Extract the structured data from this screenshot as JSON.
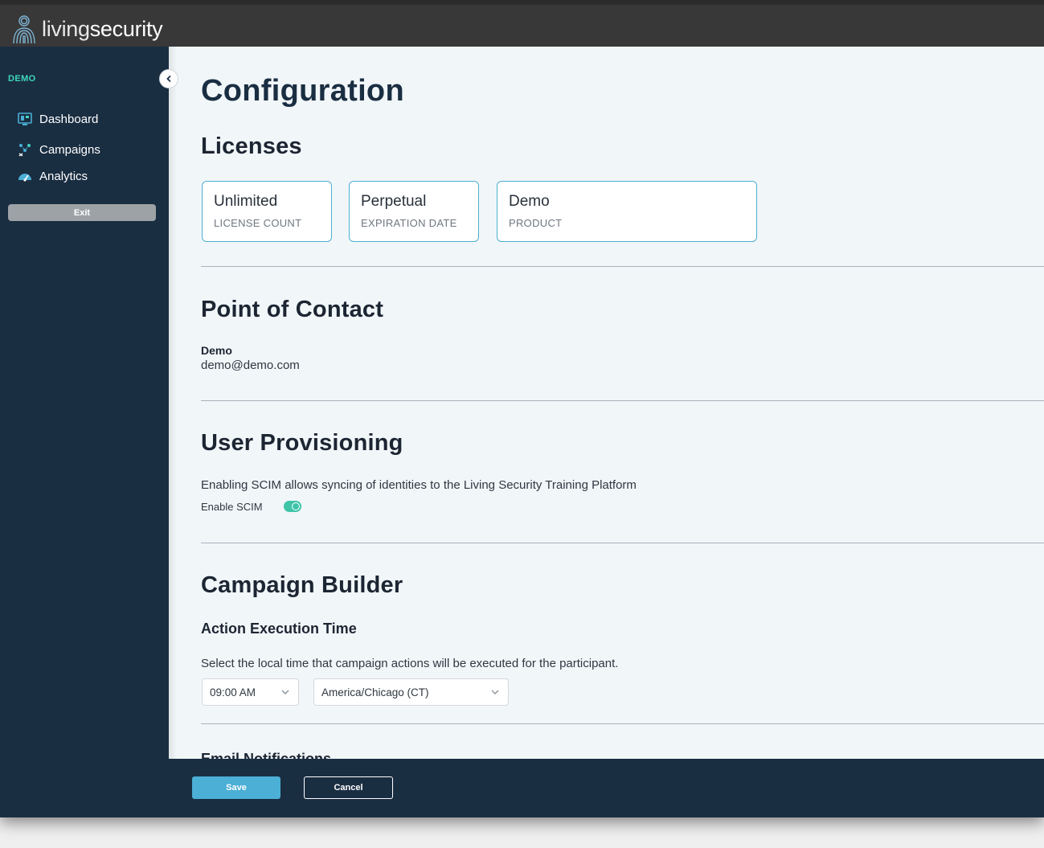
{
  "app": {
    "brand_light": "living",
    "brand_bold": "security",
    "logo_icon": "fingerprint-person-logo"
  },
  "sidebar": {
    "org": "DEMO",
    "collapse_icon": "chevron-left-icon",
    "items": [
      {
        "label": "Dashboard",
        "icon": "dashboard-icon"
      },
      {
        "label": "Campaigns",
        "icon": "campaigns-icon"
      },
      {
        "label": "Analytics",
        "icon": "analytics-icon"
      }
    ],
    "exit_label": "Exit"
  },
  "main": {
    "title": "Configuration",
    "licenses": {
      "heading": "Licenses",
      "cards": [
        {
          "value": "Unlimited",
          "caption": "LICENSE COUNT"
        },
        {
          "value": "Perpetual",
          "caption": "EXPIRATION DATE"
        },
        {
          "value": "Demo",
          "caption": "PRODUCT"
        }
      ]
    },
    "contact": {
      "heading": "Point of Contact",
      "name": "Demo",
      "email": "demo@demo.com"
    },
    "provisioning": {
      "heading": "User Provisioning",
      "description": "Enabling SCIM allows syncing of identities to the Living Security Training Platform",
      "toggle_label": "Enable SCIM",
      "toggle_on": true
    },
    "campaign_builder": {
      "heading": "Campaign Builder",
      "subheading": "Action Execution Time",
      "description": "Select the local time that campaign actions will be executed for the participant.",
      "time_value": "09:00 AM",
      "timezone_value": "America/Chicago (CT)",
      "next_heading": "Email Notifications"
    }
  },
  "footer": {
    "save_label": "Save",
    "cancel_label": "Cancel"
  },
  "colors": {
    "accent": "#3fd6bd",
    "primary_button": "#4bafd6",
    "sidebar_bg": "#1a2e42",
    "topbar_bg": "#383838"
  }
}
